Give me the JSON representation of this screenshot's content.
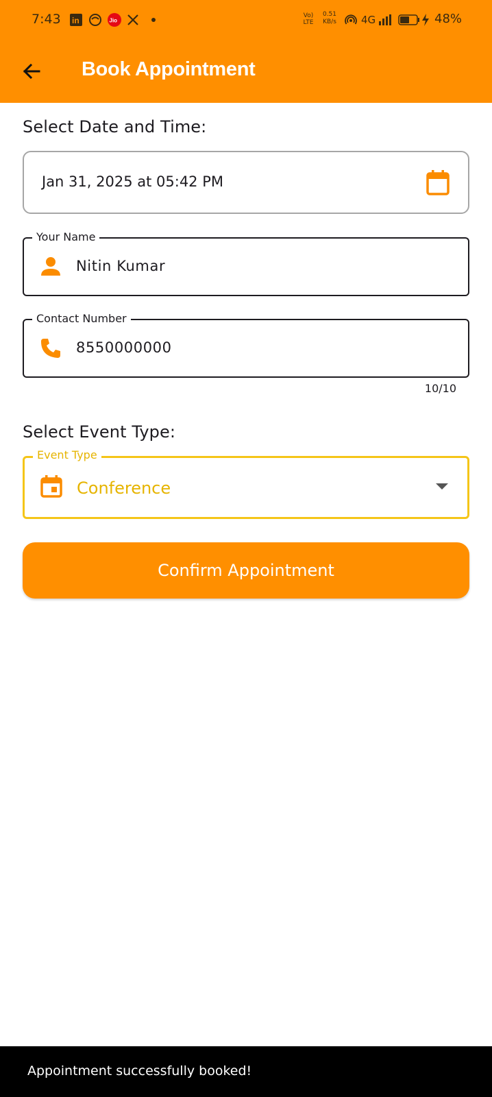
{
  "status_bar": {
    "time": "7:43",
    "icons": [
      "linkedin-icon",
      "app-icon",
      "jio-icon",
      "x-icon",
      "dot-icon"
    ],
    "network_label": "Vo) LTE",
    "speed": "0.51 KB/s",
    "signal": "4G",
    "battery": "48%"
  },
  "app_bar": {
    "title": "Book Appointment",
    "background": "#FF8F00"
  },
  "date_section": {
    "heading": "Select Date and Time:",
    "value": "Jan 31, 2025 at 05:42 PM"
  },
  "name_field": {
    "label": "Your Name",
    "value": "Nitin Kumar"
  },
  "contact_field": {
    "label": "Contact Number",
    "value": "8550000000",
    "counter": "10/10"
  },
  "event_section": {
    "heading": "Select Event Type:",
    "label": "Event Type",
    "selected": "Conference",
    "accent": "#F5C518"
  },
  "confirm_button": {
    "label": "Confirm Appointment"
  },
  "snackbar": {
    "message": "Appointment successfully booked!"
  },
  "colors": {
    "primary": "#FF8F00",
    "icon": "#FB8C00",
    "focus": "#F5C518"
  }
}
